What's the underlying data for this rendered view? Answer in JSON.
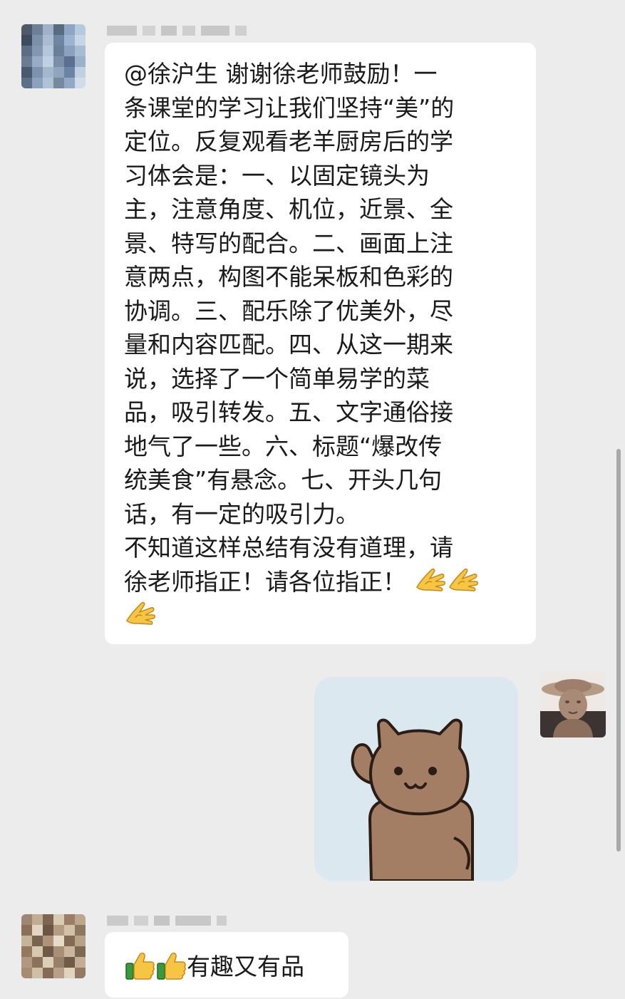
{
  "messages": {
    "first": {
      "mention": "@徐沪生",
      "lines": [
        "@徐沪生  谢谢徐老师鼓励！一",
        "条课堂的学习让我们坚持“美”的",
        "定位。反复观看老羊厨房后的学",
        "习体会是：一、以固定镜头为",
        "主，注意角度、机位，近景、全",
        "景、特写的配合。二、画面上注",
        "意两点，构图不能呆板和色彩的",
        "协调。三、配乐除了优美外，尽",
        "量和内容匹配。四、从这一期来",
        "说，选择了一个简单易学的菜",
        "品，吸引转发。五、文字通俗接",
        "地气了一些。六、标题“爆改传",
        "统美食”有悬念。七、开头几句",
        "话，有一定的吸引力。",
        "不知道这样总结有没有道理，请",
        "徐老师指正！请各位指正！"
      ],
      "trailing_emoji": [
        "ok-hand-emoji",
        "ok-hand-emoji",
        "ok-hand-emoji"
      ]
    },
    "sticker": {
      "icon": "waving-cat-sticker"
    },
    "reply": {
      "leading_emoji": [
        "thumbs-up-emoji",
        "thumbs-up-emoji"
      ],
      "text": "有趣又有品"
    }
  },
  "colors": {
    "background": "#ececec",
    "bubble": "#ffffff",
    "sticker_bg": "#dbe8ef",
    "cat_fill": "#a47e64",
    "text": "#1a1a1a"
  }
}
